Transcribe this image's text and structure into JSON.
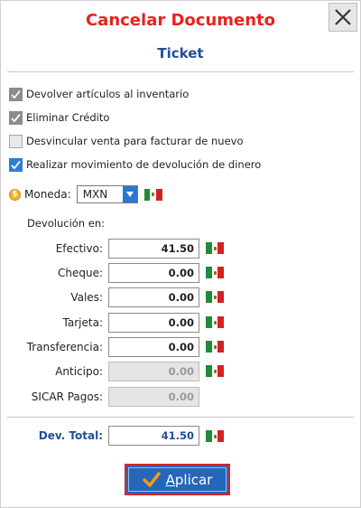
{
  "dialog": {
    "title": "Cancelar Documento",
    "subtitle": "Ticket",
    "close_icon": "close-icon"
  },
  "options": [
    {
      "label": "Devolver artículos al inventario",
      "checked": true
    },
    {
      "label": "Eliminar Crédito",
      "checked": true
    },
    {
      "label": "Desvincular venta para facturar de nuevo",
      "checked": false
    },
    {
      "label": "Realizar movimiento de devolución de dinero",
      "checked": true
    }
  ],
  "currency": {
    "label": "Moneda:",
    "selected": "MXN",
    "icon": "coin-icon",
    "flag": "mexico-flag-icon"
  },
  "refund": {
    "section_label": "Devolución en:",
    "methods": [
      {
        "label": "Efectivo:",
        "value": "41.50",
        "enabled": true,
        "flag": true
      },
      {
        "label": "Cheque:",
        "value": "0.00",
        "enabled": true,
        "flag": true
      },
      {
        "label": "Vales:",
        "value": "0.00",
        "enabled": true,
        "flag": true
      },
      {
        "label": "Tarjeta:",
        "value": "0.00",
        "enabled": true,
        "flag": true
      },
      {
        "label": "Transferencia:",
        "value": "0.00",
        "enabled": true,
        "flag": true
      },
      {
        "label": "Anticipo:",
        "value": "0.00",
        "enabled": false,
        "flag": true
      },
      {
        "label": "SICAR Pagos:",
        "value": "0.00",
        "enabled": false,
        "flag": false
      }
    ],
    "total_label": "Dev. Total:",
    "total_value": "41.50"
  },
  "actions": {
    "apply_label": "Aplicar",
    "apply_icon": "checkmark-icon"
  },
  "colors": {
    "title_red": "#e8221b",
    "subtitle_blue": "#1f4e9b",
    "button_blue": "#2466b8",
    "button_border_red": "#d6242a",
    "check_blue": "#2f7cd6",
    "check_orange": "#f39a1e"
  }
}
